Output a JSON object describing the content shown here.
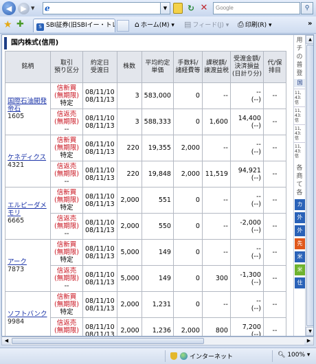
{
  "browser": {
    "address_icon": "e",
    "search_placeholder": "Google",
    "tab_title": "SBI証券(旧SBIイー・トレー...",
    "tab_icon": "S",
    "home_label": "ホーム(M)",
    "feed_label": "フィード(J)",
    "print_label": "印刷(R)",
    "zone_label": "インターネット",
    "zoom_label": "100%"
  },
  "page": {
    "section_title": "国内株式(信用)",
    "headers": {
      "name": "銘柄",
      "side": "取引\n預り区分",
      "dates": "約定日\n受渡日",
      "qty": "株数",
      "price": "平均約定\n単価",
      "fee": "手数料/\n諸経費等",
      "tax": "課税額/\n譲渡益税",
      "pl": "受渡金額/\n決済損益\n(日計り分)",
      "misc": "代/保\n排目"
    },
    "stocks": [
      {
        "name": "国際石油開発帝石",
        "code": "1605",
        "rows": [
          {
            "side1": "信新買",
            "side2": "(無期限)",
            "side3": "特定",
            "trade_date": "08/11/10",
            "settle_date": "08/11/13",
            "qty": "3",
            "price": "583,000",
            "fee": "0",
            "tax": "--",
            "pl1": "--",
            "pl2": "(--)",
            "misc": "--"
          },
          {
            "side1": "信返売",
            "side2": "(無期限)",
            "side3": "--",
            "trade_date": "08/11/10",
            "settle_date": "08/11/13",
            "qty": "3",
            "price": "588,333",
            "fee": "0",
            "tax": "1,600",
            "pl1": "14,400",
            "pl2": "(--)",
            "misc": "--"
          }
        ]
      },
      {
        "name": "ケネディクス",
        "code": "4321",
        "rows": [
          {
            "side1": "信新買",
            "side2": "(無期限)",
            "side3": "特定",
            "trade_date": "08/11/10",
            "settle_date": "08/11/13",
            "qty": "220",
            "price": "19,355",
            "fee": "2,000",
            "tax": "--",
            "pl1": "--",
            "pl2": "(--)",
            "misc": "--"
          },
          {
            "side1": "信返売",
            "side2": "(無期限)",
            "side3": "--",
            "trade_date": "08/11/10",
            "settle_date": "08/11/13",
            "qty": "220",
            "price": "19,848",
            "fee": "2,000",
            "tax": "11,519",
            "pl1": "94,921",
            "pl2": "(--)",
            "misc": "--"
          }
        ]
      },
      {
        "name": "エルピーダメモリ",
        "code": "6665",
        "rows": [
          {
            "side1": "信新買",
            "side2": "(無期限)",
            "side3": "特定",
            "trade_date": "08/11/10",
            "settle_date": "08/11/13",
            "qty": "2,000",
            "price": "551",
            "fee": "0",
            "tax": "--",
            "pl1": "--",
            "pl2": "(--)",
            "misc": "--"
          },
          {
            "side1": "信返売",
            "side2": "(無期限)",
            "side3": "--",
            "trade_date": "08/11/10",
            "settle_date": "08/11/13",
            "qty": "2,000",
            "price": "550",
            "fee": "0",
            "tax": "--",
            "pl1": "-2,000",
            "pl2": "(--)",
            "misc": "--"
          }
        ]
      },
      {
        "name": "アーク",
        "code": "7873",
        "rows": [
          {
            "side1": "信新買",
            "side2": "(無期限)",
            "side3": "特定",
            "trade_date": "08/11/10",
            "settle_date": "08/11/13",
            "qty": "5,000",
            "price": "149",
            "fee": "0",
            "tax": "--",
            "pl1": "--",
            "pl2": "(--)",
            "misc": "--"
          },
          {
            "side1": "信返売",
            "side2": "(無期限)",
            "side3": "--",
            "trade_date": "08/11/10",
            "settle_date": "08/11/13",
            "qty": "5,000",
            "price": "149",
            "fee": "0",
            "tax": "300",
            "pl1": "-1,300",
            "pl2": "(--)",
            "misc": "--"
          }
        ]
      },
      {
        "name": "ソフトバンク",
        "code": "9984",
        "rows": [
          {
            "side1": "信新買",
            "side2": "(無期限)",
            "side3": "特定",
            "trade_date": "08/11/10",
            "settle_date": "08/11/13",
            "qty": "2,000",
            "price": "1,231",
            "fee": "0",
            "tax": "--",
            "pl1": "--",
            "pl2": "(--)",
            "misc": "--"
          },
          {
            "side1": "信返売",
            "side2": "(無期限)",
            "side3": "--",
            "trade_date": "08/11/10",
            "settle_date": "08/11/13",
            "qty": "2,000",
            "price": "1,236",
            "fee": "2,000",
            "tax": "800",
            "pl1": "7,200",
            "pl2": "(--)",
            "misc": "--"
          }
        ]
      }
    ]
  },
  "side_panel": {
    "top_chars": [
      "用",
      "チ",
      "の",
      "普",
      "登"
    ],
    "box_label": "国",
    "blocks": [
      {
        "lines": [
          "11,",
          "43:",
          "信"
        ]
      },
      {
        "lines": [
          "11,",
          "43:",
          "信"
        ]
      },
      {
        "lines": [
          "11,",
          "43:",
          "信"
        ]
      },
      {
        "lines": [
          "11,",
          "43:",
          "信"
        ]
      }
    ],
    "mid_chars": [
      "各",
      "商",
      "て",
      "各"
    ],
    "buttons": [
      {
        "label": "カ",
        "color": "#2a62b8"
      },
      {
        "label": "外",
        "color": "#2a62b8"
      },
      {
        "label": "外",
        "color": "#2a62b8"
      },
      {
        "label": "先",
        "color": "#e0581c"
      },
      {
        "label": "米",
        "color": "#2a62b8"
      },
      {
        "label": "米",
        "color": "#6fb32e"
      },
      {
        "label": "住",
        "color": "#2a62b8"
      }
    ]
  }
}
